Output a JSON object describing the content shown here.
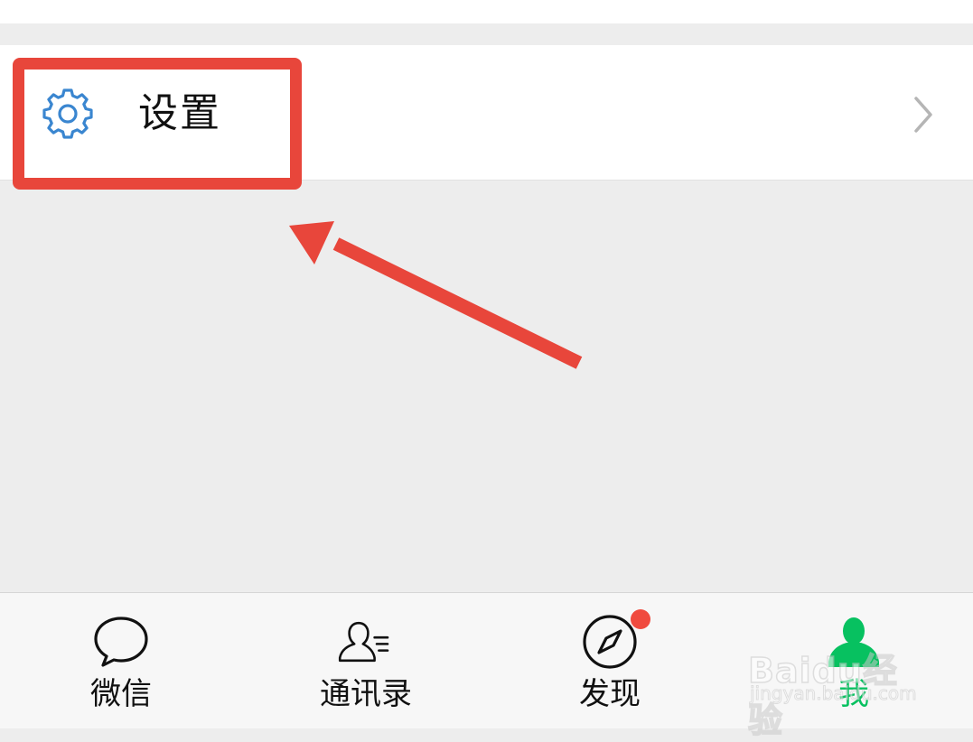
{
  "settings_row": {
    "label": "设置",
    "icon": "gear-icon",
    "chevron": "chevron-right-icon"
  },
  "annotation": {
    "highlight_color": "#e8463b",
    "arrow": "arrow-icon"
  },
  "tabbar": {
    "tabs": [
      {
        "label": "微信",
        "icon": "chat-bubble-icon",
        "active": false
      },
      {
        "label": "通讯录",
        "icon": "contacts-icon",
        "active": false
      },
      {
        "label": "发现",
        "icon": "compass-icon",
        "active": false,
        "badge": true
      },
      {
        "label": "我",
        "icon": "profile-icon",
        "active": true
      }
    ],
    "active_color": "#07c160",
    "badge_color": "#f04a3e"
  },
  "watermark": {
    "brand": "Baidu经验",
    "sub": "jingyan.baidu.com"
  }
}
